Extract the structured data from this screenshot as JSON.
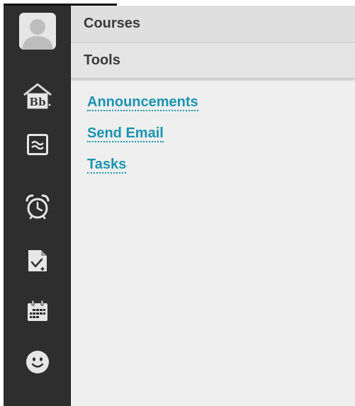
{
  "colors": {
    "sidebar": "#2e2e2e",
    "link": "#1a93b0",
    "panel": "#efefef"
  },
  "sidebar": {
    "items": [
      {
        "icon": "avatar"
      },
      {
        "icon": "bb-home-icon"
      },
      {
        "icon": "stream-icon"
      },
      {
        "icon": "alarm-clock-icon"
      },
      {
        "icon": "grades-document-icon"
      },
      {
        "icon": "calendar-icon"
      },
      {
        "icon": "smiley-icon"
      }
    ]
  },
  "header": {
    "tabs": [
      {
        "label": "Courses"
      },
      {
        "label": "Tools"
      }
    ]
  },
  "tools": {
    "links": [
      {
        "label": "Announcements"
      },
      {
        "label": "Send Email"
      },
      {
        "label": "Tasks"
      }
    ]
  }
}
